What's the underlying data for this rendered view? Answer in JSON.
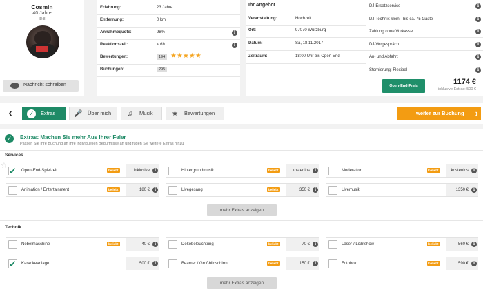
{
  "profile": {
    "name": "Cosmin",
    "age": "40 Jahre",
    "id": "ID:8",
    "message_button": "Nachricht schreiben"
  },
  "stats": [
    {
      "label": "Erfahrung:",
      "value": "23 Jahre"
    },
    {
      "label": "Entfernung:",
      "value": "0 km"
    },
    {
      "label": "Annahmequote:",
      "value": "98%"
    },
    {
      "label": "Reaktionszeit:",
      "value": "< 6h"
    },
    {
      "label": "Bewertungen:",
      "value": "194",
      "stars": 5
    },
    {
      "label": "Buchungen:",
      "value": "295"
    }
  ],
  "angebot": {
    "title": "Ihr Angebot",
    "rows": [
      {
        "label": "Veranstaltung:",
        "value": "Hochzeit"
      },
      {
        "label": "Ort:",
        "value": "97070 Würzburg"
      },
      {
        "label": "Datum:",
        "value": "Sa, 18.11.2017"
      },
      {
        "label": "Zeitraum:",
        "value": "18:00 Uhr bis Open-End"
      }
    ],
    "services": [
      "DJ-Ersatzservice",
      "DJ-Technik klein - bis ca. 75 Gäste",
      "Zahlung ohne Vorkasse",
      "DJ-Vorgespräch",
      "An- und Abfahrt",
      "Stornierung: Flexibel"
    ],
    "price_button": "Open-End-Preis",
    "price": "1174 €",
    "price_note": "inklusive Extras: 500 €"
  },
  "nav": {
    "back": "‹",
    "tabs": [
      "Extras",
      "Über mich",
      "Musik",
      "Bewertungen"
    ],
    "booking_button": "weiter zur Buchung",
    "booking_arrow": "›"
  },
  "extras_header": {
    "title": "Extras: Machen Sie mehr Aus Ihrer Feier",
    "subtitle": "Passen Sie Ihre Buchung an Ihre individuellen Bedürfnisse an und fügen Sie weitere Extras hinzu"
  },
  "badge_label": "beliebt",
  "services_section": {
    "title": "Services",
    "items": [
      {
        "name": "Open-End-Spielzeit",
        "price": "inklusive",
        "badge": true,
        "checked": true
      },
      {
        "name": "Hintergrundmusik",
        "price": "kostenlos",
        "badge": true,
        "checked": false
      },
      {
        "name": "Moderation",
        "price": "kostenlos",
        "badge": true,
        "checked": false
      },
      {
        "name": "Animation / Entertainment",
        "price": "180 €",
        "badge": true,
        "checked": false
      },
      {
        "name": "Livegesang",
        "price": "350 €",
        "badge": true,
        "checked": false
      },
      {
        "name": "Livemusik",
        "price": "1350 €",
        "badge": false,
        "checked": false
      }
    ],
    "more_button": "mehr Extras anzeigen"
  },
  "technik_section": {
    "title": "Technik",
    "items": [
      {
        "name": "Nebelmaschine",
        "price": "40 €",
        "badge": true,
        "checked": false
      },
      {
        "name": "Dekobeleuchtung",
        "price": "70 €",
        "badge": true,
        "checked": false
      },
      {
        "name": "Laser-/ Lichtshow",
        "price": "560 €",
        "badge": true,
        "checked": false
      },
      {
        "name": "Karaokeanlage",
        "price": "500 €",
        "badge": false,
        "checked": true
      },
      {
        "name": "Beamer / Großbildschirm",
        "price": "150 €",
        "badge": true,
        "checked": false
      },
      {
        "name": "Fotobox",
        "price": "590 €",
        "badge": true,
        "checked": false
      }
    ],
    "more_button": "mehr Extras anzeigen"
  },
  "colors": {
    "green": "#1f8f6a",
    "orange": "#f39c12",
    "tab_active": "#1e8a66"
  }
}
